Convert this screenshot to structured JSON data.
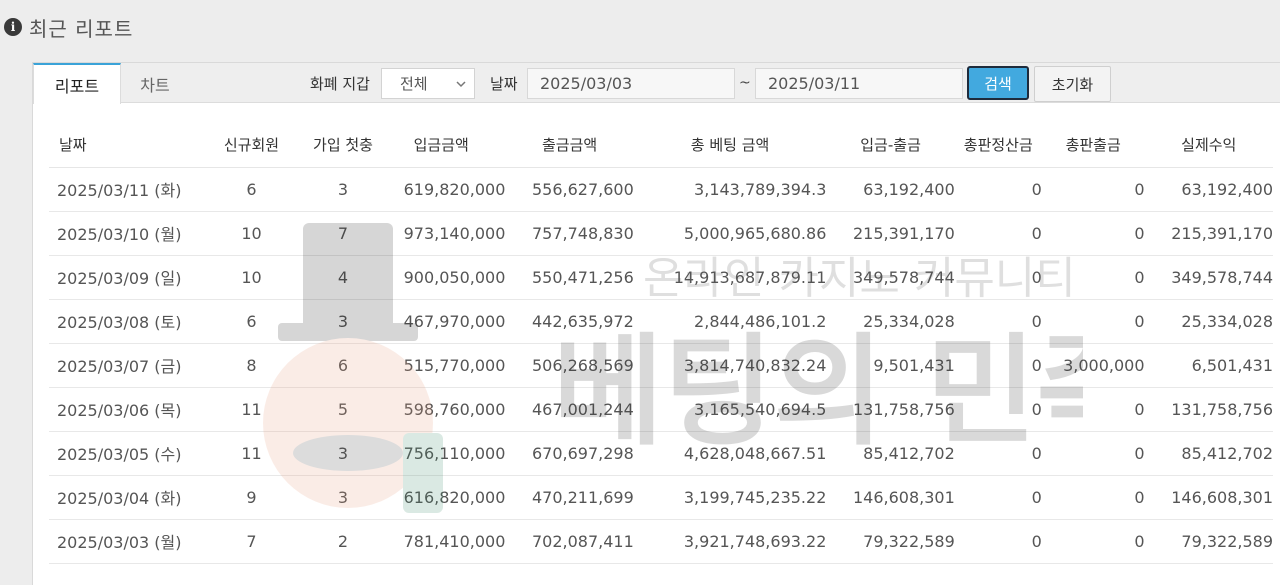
{
  "page_title": "최근 리포트",
  "tabs": [
    {
      "label": "리포트",
      "active": true
    },
    {
      "label": "차트",
      "active": false
    }
  ],
  "filters": {
    "currency_label": "화폐 지갑",
    "currency_value": "전체",
    "date_label": "날짜",
    "start_date": "2025/03/03",
    "end_date": "2025/03/11",
    "range_separator": "~",
    "search_button": "검색",
    "reset_button": "초기화"
  },
  "table": {
    "headers": [
      "날짜",
      "신규회원",
      "가입 첫충",
      "입금금액",
      "출금금액",
      "총 베팅 금액",
      "입금-출금",
      "총판정산금",
      "총판출금",
      "실제수익"
    ],
    "rows": [
      [
        "2025/03/11 (화)",
        "6",
        "3",
        "619,820,000",
        "556,627,600",
        "3,143,789,394.3",
        "63,192,400",
        "0",
        "0",
        "63,192,400"
      ],
      [
        "2025/03/10 (월)",
        "10",
        "7",
        "973,140,000",
        "757,748,830",
        "5,000,965,680.86",
        "215,391,170",
        "0",
        "0",
        "215,391,170"
      ],
      [
        "2025/03/09 (일)",
        "10",
        "4",
        "900,050,000",
        "550,471,256",
        "14,913,687,879.11",
        "349,578,744",
        "0",
        "0",
        "349,578,744"
      ],
      [
        "2025/03/08 (토)",
        "6",
        "3",
        "467,970,000",
        "442,635,972",
        "2,844,486,101.2",
        "25,334,028",
        "0",
        "0",
        "25,334,028"
      ],
      [
        "2025/03/07 (금)",
        "8",
        "6",
        "515,770,000",
        "506,268,569",
        "3,814,740,832.24",
        "9,501,431",
        "0",
        "3,000,000",
        "6,501,431"
      ],
      [
        "2025/03/06 (목)",
        "11",
        "5",
        "598,760,000",
        "467,001,244",
        "3,165,540,694.5",
        "131,758,756",
        "0",
        "0",
        "131,758,756"
      ],
      [
        "2025/03/05 (수)",
        "11",
        "3",
        "756,110,000",
        "670,697,298",
        "4,628,048,667.51",
        "85,412,702",
        "0",
        "0",
        "85,412,702"
      ],
      [
        "2025/03/04 (화)",
        "9",
        "3",
        "616,820,000",
        "470,211,699",
        "3,199,745,235.22",
        "146,608,301",
        "0",
        "0",
        "146,608,301"
      ],
      [
        "2025/03/03 (월)",
        "7",
        "2",
        "781,410,000",
        "702,087,411",
        "3,921,748,693.22",
        "79,322,589",
        "0",
        "0",
        "79,322,589"
      ]
    ]
  },
  "watermark": {
    "line1": "온라인 카지노 커뮤니티",
    "line2": "베팅의 민족"
  },
  "icons": {
    "info": "info-circle-icon",
    "dropdown": "chevron-down-icon"
  }
}
